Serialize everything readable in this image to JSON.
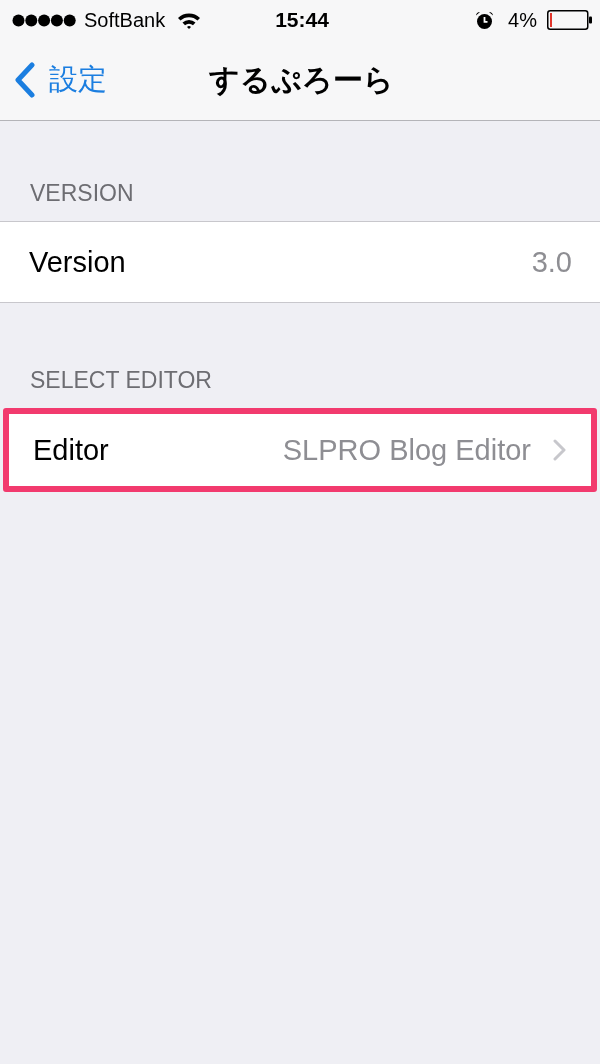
{
  "status_bar": {
    "carrier": "SoftBank",
    "time": "15:44",
    "battery_percent": "4%"
  },
  "nav_bar": {
    "back_label": "設定",
    "title": "するぷろーら"
  },
  "sections": [
    {
      "header": "VERSION",
      "rows": [
        {
          "kind": "value",
          "label": "Version",
          "value": "3.0",
          "highlighted": false
        }
      ]
    },
    {
      "header": "SELECT EDITOR",
      "rows": [
        {
          "kind": "disclosure",
          "label": "Editor",
          "value": "SLPRO Blog Editor",
          "highlighted": true
        }
      ]
    }
  ]
}
